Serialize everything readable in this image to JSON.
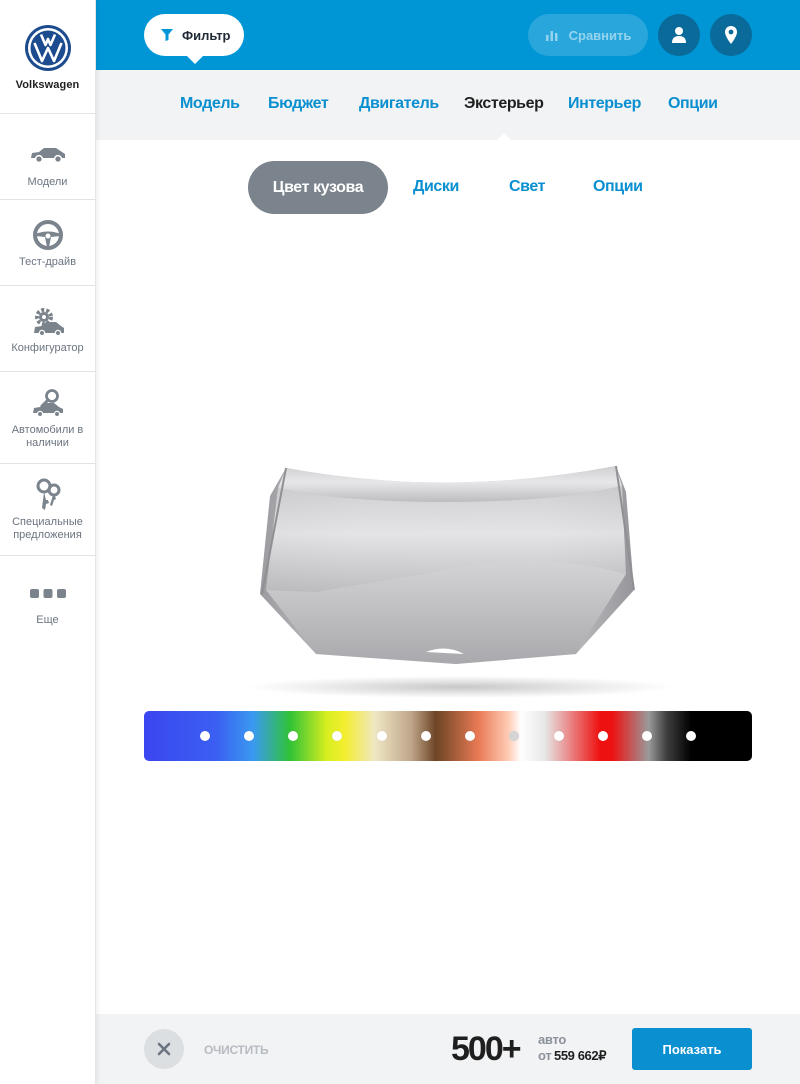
{
  "sidebar": {
    "brand": "Volkswagen",
    "items": [
      {
        "label": "Модели",
        "icon": "car-icon"
      },
      {
        "label": "Тест-драйв",
        "icon": "steering-wheel-icon"
      },
      {
        "label": "Конфигуратор",
        "icon": "configurator-gear-car-icon"
      },
      {
        "label": "Автомобили в наличии",
        "icon": "car-search-icon"
      },
      {
        "label": "Специальные предложения",
        "icon": "keys-icon"
      },
      {
        "label": "Еще",
        "icon": "more-dots-icon"
      }
    ]
  },
  "header": {
    "filter_label": "Фильтр",
    "compare_label": "Сравнить"
  },
  "category_tabs": [
    {
      "label": "Модель"
    },
    {
      "label": "Бюджет"
    },
    {
      "label": "Двигатель"
    },
    {
      "label": "Экстерьер",
      "active": true
    },
    {
      "label": "Интерьер"
    },
    {
      "label": "Опции"
    }
  ],
  "sub_tabs": [
    {
      "label": "Цвет кузова",
      "active": true
    },
    {
      "label": "Диски"
    },
    {
      "label": "Свет"
    },
    {
      "label": "Опции"
    }
  ],
  "colors": [
    "#3a46f0",
    "#3a86f0",
    "#2fc02f",
    "#f0ec24",
    "#efe7c3",
    "#8a6246",
    "#ef8a63",
    "#f5f5f5",
    "#e2e2e2",
    "#ee1111",
    "#555555",
    "#000000"
  ],
  "footer": {
    "clear_label": "ОЧИСТИТЬ",
    "count": "500+",
    "count_unit": "авто",
    "price_prefix": "от",
    "price": "559 662₽",
    "show_label": "Показать"
  }
}
